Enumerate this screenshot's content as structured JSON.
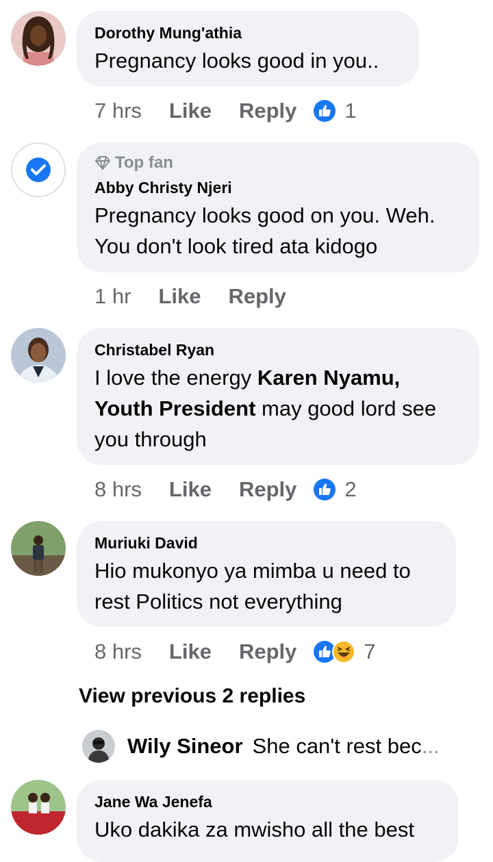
{
  "comments": [
    {
      "author": "Dorothy Mung'athia",
      "text": "Pregnancy looks good in you..",
      "time": "7 hrs",
      "like": "Like",
      "reply": "Reply",
      "reaction_count": "1",
      "reactions": [
        "like-icon"
      ]
    },
    {
      "badge": "Top fan",
      "author": "Abby Christy Njeri",
      "text_line1": "Pregnancy looks good on you. Weh.",
      "text_line2": "You don't look tired ata kidogo",
      "time": "1 hr",
      "like": "Like",
      "reply": "Reply"
    },
    {
      "author": "Christabel Ryan",
      "text_part1": "I love the energy ",
      "mention_line1": "Karen Nyamu,",
      "mention_line2": "Youth President",
      "text_part2": " may good lord see",
      "text_part3": "you through",
      "time": "8 hrs",
      "like": "Like",
      "reply": "Reply",
      "reaction_count": "2",
      "reactions": [
        "like-icon"
      ]
    },
    {
      "author": "Muriuki David",
      "text_line1": "Hio mukonyo ya mimba u need to",
      "text_line2": "rest Politics not everything",
      "time": "8 hrs",
      "like": "Like",
      "reply": "Reply",
      "reaction_count": "7",
      "reactions": [
        "like-icon",
        "haha-icon"
      ]
    },
    {
      "author": "Jane Wa Jenefa",
      "text": "Uko dakika za mwisho all the best"
    }
  ],
  "view_previous": "View previous 2 replies",
  "reply_preview": {
    "author": "Wily Sineor",
    "text": "She can't rest bec",
    "ellipsis": "..."
  },
  "colors": {
    "bubble": "#f0f2f5",
    "meta_text": "#65676b",
    "like_blue": "#1877f2",
    "haha_yellow": "#f7b928"
  }
}
